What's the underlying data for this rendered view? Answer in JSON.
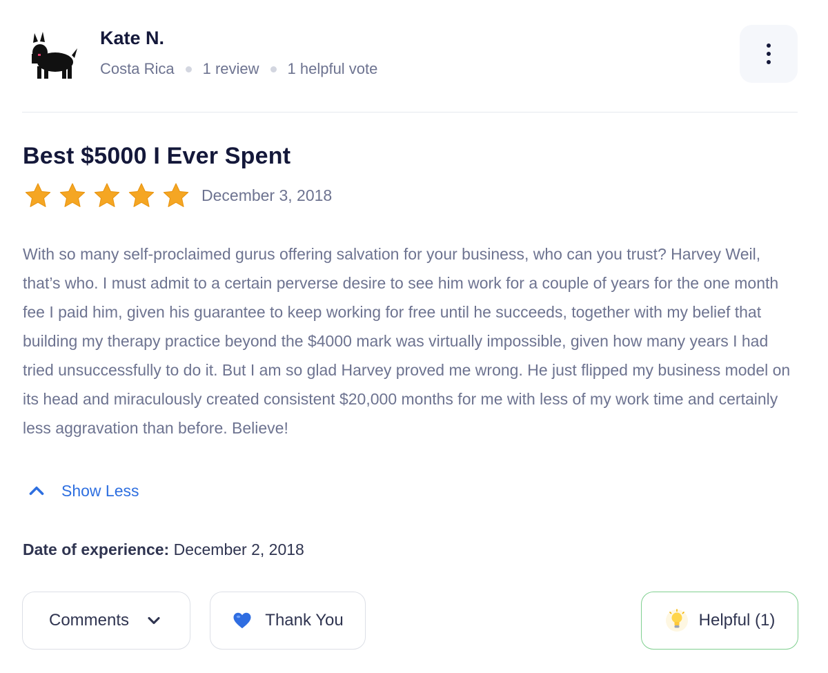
{
  "reviewer": {
    "name": "Kate N.",
    "country": "Costa Rica",
    "reviews": "1 review",
    "helpful_votes": "1 helpful vote"
  },
  "review": {
    "title": "Best $5000 I Ever Spent",
    "rating": 5,
    "rating_max": 5,
    "date": "December 3, 2018",
    "body": "With so many self-proclaimed gurus offering salvation for your business, who can you trust? Harvey Weil, that’s who. I must admit to a certain perverse desire to see him work for a couple of years for the one month fee I paid him, given his guarantee to keep working for free until he succeeds, together with my belief that building my therapy practice beyond the $4000 mark was virtually impossible, given how many years I had tried unsuccessfully to do it. But I am so glad Harvey proved me wrong. He just flipped my business model on its head and miraculously created consistent $20,000 months for me with less of my work time and certainly less aggravation than before. Believe!",
    "show_less_label": "Show Less",
    "experience_label": "Date of experience:",
    "experience_date": "December 2, 2018"
  },
  "actions": {
    "comments_label": "Comments",
    "thank_you_label": "Thank You",
    "helpful_label": "Helpful (1)"
  },
  "icons": {
    "avatar": "scottish-terrier-dog-avatar",
    "more": "vertical-ellipsis-icon",
    "star": "star-icon",
    "show_less": "chevron-up-icon",
    "comments": "chevron-down-icon",
    "thank_you": "blue-heart-icon",
    "helpful": "lightbulb-icon"
  },
  "colors": {
    "star": "#f5a623",
    "link": "#2e6fe0",
    "helpful_border": "#7fcf8f",
    "heart": "#2f6de1"
  }
}
